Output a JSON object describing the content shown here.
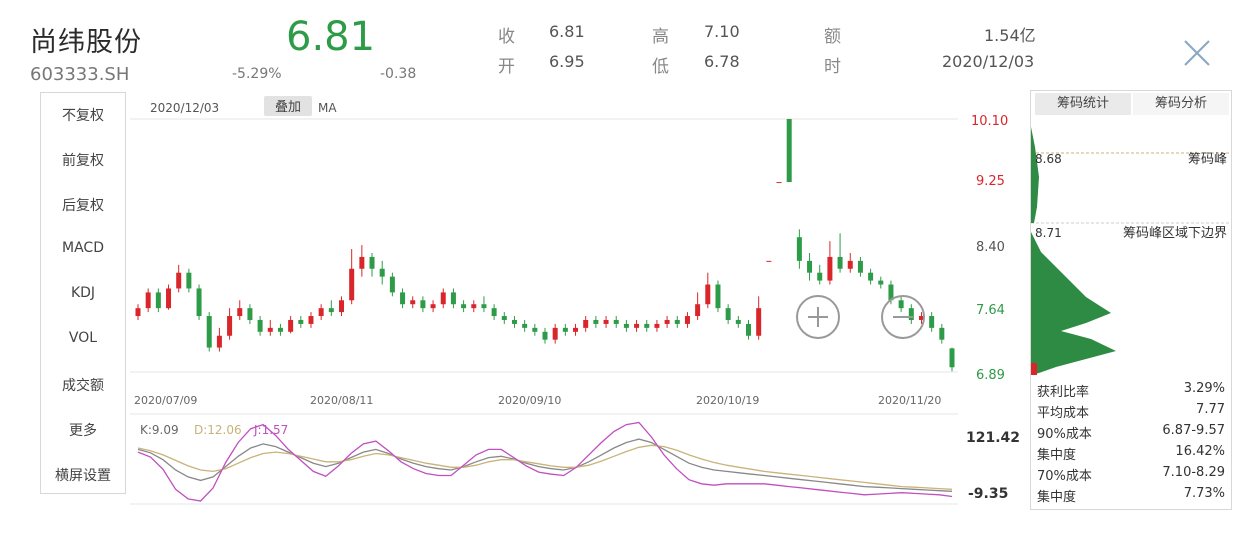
{
  "header": {
    "stock_name": "尚纬股份",
    "stock_code": "603333.SH",
    "price": "6.81",
    "change_pct": "-5.29%",
    "change_amt": "-0.38",
    "price_color": "#2e9b48",
    "quote": {
      "close_label": "收",
      "close_value": "6.81",
      "open_label": "开",
      "open_value": "6.95",
      "high_label": "高",
      "high_value": "7.10",
      "low_label": "低",
      "low_value": "6.78",
      "amount_label": "额",
      "amount_value": "1.54亿",
      "time_label": "时",
      "time_value": "2020/12/03"
    },
    "close_icon": "close-icon"
  },
  "left_menu": [
    {
      "label": "不复权",
      "active": false
    },
    {
      "label": "前复权",
      "active": true
    },
    {
      "label": "后复权",
      "active": false
    },
    {
      "label": "MACD",
      "active": false
    },
    {
      "label": "KDJ",
      "active": true
    },
    {
      "label": "VOL",
      "active": false
    },
    {
      "label": "成交额",
      "active": false
    },
    {
      "label": "更多",
      "active": false
    },
    {
      "label": "横屏设置",
      "active": true
    }
  ],
  "chart": {
    "date_label": "2020/12/03",
    "overlay_button": "叠加",
    "ma_label": "MA",
    "zoom_in_icon": "zoom-in-icon",
    "zoom_out_icon": "zoom-out-icon",
    "up_color": "#d9262b",
    "down_color": "#2e9b48"
  },
  "chart_data": [
    {
      "type": "candlestick",
      "title": "",
      "ylim": [
        6.89,
        10.1
      ],
      "y_ticks": [
        "10.10",
        "9.25",
        "8.40",
        "7.64",
        "6.89"
      ],
      "x_ticks": [
        "2020/07/09",
        "2020/08/11",
        "2020/09/10",
        "2020/10/19",
        "2020/11/20"
      ],
      "series": [
        {
          "o": 7.6,
          "c": 7.7,
          "h": 7.75,
          "l": 7.55
        },
        {
          "o": 7.7,
          "c": 7.9,
          "h": 7.95,
          "l": 7.65
        },
        {
          "o": 7.9,
          "c": 7.7,
          "h": 7.95,
          "l": 7.65
        },
        {
          "o": 7.7,
          "c": 7.95,
          "h": 8.0,
          "l": 7.68
        },
        {
          "o": 7.95,
          "c": 8.15,
          "h": 8.25,
          "l": 7.9
        },
        {
          "o": 8.15,
          "c": 7.95,
          "h": 8.2,
          "l": 7.9
        },
        {
          "o": 7.95,
          "c": 7.6,
          "h": 8.0,
          "l": 7.55
        },
        {
          "o": 7.6,
          "c": 7.2,
          "h": 7.65,
          "l": 7.15
        },
        {
          "o": 7.2,
          "c": 7.35,
          "h": 7.45,
          "l": 7.15
        },
        {
          "o": 7.35,
          "c": 7.6,
          "h": 7.7,
          "l": 7.3
        },
        {
          "o": 7.6,
          "c": 7.7,
          "h": 7.8,
          "l": 7.55
        },
        {
          "o": 7.7,
          "c": 7.55,
          "h": 7.75,
          "l": 7.5
        },
        {
          "o": 7.55,
          "c": 7.4,
          "h": 7.6,
          "l": 7.35
        },
        {
          "o": 7.4,
          "c": 7.45,
          "h": 7.55,
          "l": 7.35
        },
        {
          "o": 7.45,
          "c": 7.4,
          "h": 7.5,
          "l": 7.35
        },
        {
          "o": 7.4,
          "c": 7.55,
          "h": 7.6,
          "l": 7.38
        },
        {
          "o": 7.55,
          "c": 7.5,
          "h": 7.6,
          "l": 7.45
        },
        {
          "o": 7.5,
          "c": 7.6,
          "h": 7.65,
          "l": 7.45
        },
        {
          "o": 7.6,
          "c": 7.7,
          "h": 7.75,
          "l": 7.55
        },
        {
          "o": 7.7,
          "c": 7.65,
          "h": 7.8,
          "l": 7.6
        },
        {
          "o": 7.65,
          "c": 7.8,
          "h": 7.85,
          "l": 7.6
        },
        {
          "o": 7.8,
          "c": 8.2,
          "h": 8.45,
          "l": 7.75
        },
        {
          "o": 8.2,
          "c": 8.35,
          "h": 8.5,
          "l": 8.1
        },
        {
          "o": 8.35,
          "c": 8.2,
          "h": 8.4,
          "l": 8.1
        },
        {
          "o": 8.2,
          "c": 8.1,
          "h": 8.3,
          "l": 8.0
        },
        {
          "o": 8.1,
          "c": 7.9,
          "h": 8.15,
          "l": 7.85
        },
        {
          "o": 7.9,
          "c": 7.75,
          "h": 7.95,
          "l": 7.7
        },
        {
          "o": 7.75,
          "c": 7.8,
          "h": 7.85,
          "l": 7.7
        },
        {
          "o": 7.8,
          "c": 7.7,
          "h": 7.85,
          "l": 7.65
        },
        {
          "o": 7.7,
          "c": 7.75,
          "h": 7.8,
          "l": 7.65
        },
        {
          "o": 7.75,
          "c": 7.9,
          "h": 7.95,
          "l": 7.7
        },
        {
          "o": 7.9,
          "c": 7.75,
          "h": 7.95,
          "l": 7.7
        },
        {
          "o": 7.75,
          "c": 7.7,
          "h": 7.8,
          "l": 7.65
        },
        {
          "o": 7.7,
          "c": 7.75,
          "h": 7.8,
          "l": 7.65
        },
        {
          "o": 7.75,
          "c": 7.7,
          "h": 7.85,
          "l": 7.65
        },
        {
          "o": 7.7,
          "c": 7.6,
          "h": 7.75,
          "l": 7.55
        },
        {
          "o": 7.6,
          "c": 7.55,
          "h": 7.65,
          "l": 7.5
        },
        {
          "o": 7.55,
          "c": 7.5,
          "h": 7.6,
          "l": 7.45
        },
        {
          "o": 7.5,
          "c": 7.45,
          "h": 7.55,
          "l": 7.4
        },
        {
          "o": 7.45,
          "c": 7.4,
          "h": 7.5,
          "l": 7.35
        },
        {
          "o": 7.4,
          "c": 7.3,
          "h": 7.45,
          "l": 7.25
        },
        {
          "o": 7.3,
          "c": 7.45,
          "h": 7.5,
          "l": 7.25
        },
        {
          "o": 7.45,
          "c": 7.4,
          "h": 7.5,
          "l": 7.35
        },
        {
          "o": 7.4,
          "c": 7.45,
          "h": 7.5,
          "l": 7.35
        },
        {
          "o": 7.45,
          "c": 7.55,
          "h": 7.6,
          "l": 7.4
        },
        {
          "o": 7.55,
          "c": 7.5,
          "h": 7.6,
          "l": 7.45
        },
        {
          "o": 7.5,
          "c": 7.55,
          "h": 7.6,
          "l": 7.45
        },
        {
          "o": 7.55,
          "c": 7.5,
          "h": 7.6,
          "l": 7.45
        },
        {
          "o": 7.5,
          "c": 7.45,
          "h": 7.55,
          "l": 7.4
        },
        {
          "o": 7.45,
          "c": 7.5,
          "h": 7.55,
          "l": 7.4
        },
        {
          "o": 7.5,
          "c": 7.45,
          "h": 7.55,
          "l": 7.4
        },
        {
          "o": 7.45,
          "c": 7.5,
          "h": 7.55,
          "l": 7.4
        },
        {
          "o": 7.5,
          "c": 7.55,
          "h": 7.6,
          "l": 7.45
        },
        {
          "o": 7.55,
          "c": 7.5,
          "h": 7.6,
          "l": 7.45
        },
        {
          "o": 7.5,
          "c": 7.6,
          "h": 7.65,
          "l": 7.45
        },
        {
          "o": 7.6,
          "c": 7.75,
          "h": 7.9,
          "l": 7.55
        },
        {
          "o": 7.75,
          "c": 8.0,
          "h": 8.15,
          "l": 7.7
        },
        {
          "o": 8.0,
          "c": 7.7,
          "h": 8.05,
          "l": 7.65
        },
        {
          "o": 7.7,
          "c": 7.55,
          "h": 7.75,
          "l": 7.5
        },
        {
          "o": 7.55,
          "c": 7.5,
          "h": 7.6,
          "l": 7.45
        },
        {
          "o": 7.5,
          "c": 7.35,
          "h": 7.55,
          "l": 7.3
        },
        {
          "o": 7.35,
          "c": 7.7,
          "h": 7.85,
          "l": 7.3
        },
        {
          "o": 8.3,
          "c": 8.3,
          "h": 8.3,
          "l": 8.3
        },
        {
          "o": 9.3,
          "c": 9.3,
          "h": 9.3,
          "l": 9.3
        },
        {
          "o": 10.1,
          "c": 9.3,
          "h": 10.1,
          "l": 9.3
        },
        {
          "o": 8.6,
          "c": 8.3,
          "h": 8.7,
          "l": 8.2
        },
        {
          "o": 8.3,
          "c": 8.15,
          "h": 8.4,
          "l": 8.05
        },
        {
          "o": 8.15,
          "c": 8.05,
          "h": 8.25,
          "l": 8.0
        },
        {
          "o": 8.05,
          "c": 8.35,
          "h": 8.55,
          "l": 8.0
        },
        {
          "o": 8.35,
          "c": 8.2,
          "h": 8.65,
          "l": 8.15
        },
        {
          "o": 8.2,
          "c": 8.3,
          "h": 8.4,
          "l": 8.15
        },
        {
          "o": 8.3,
          "c": 8.15,
          "h": 8.35,
          "l": 8.1
        },
        {
          "o": 8.15,
          "c": 8.05,
          "h": 8.2,
          "l": 8.0
        },
        {
          "o": 8.05,
          "c": 8.0,
          "h": 8.1,
          "l": 7.95
        },
        {
          "o": 8.0,
          "c": 7.8,
          "h": 8.05,
          "l": 7.75
        },
        {
          "o": 7.8,
          "c": 7.7,
          "h": 7.85,
          "l": 7.65
        },
        {
          "o": 7.7,
          "c": 7.55,
          "h": 7.75,
          "l": 7.5
        },
        {
          "o": 7.55,
          "c": 7.6,
          "h": 7.65,
          "l": 7.5
        },
        {
          "o": 7.6,
          "c": 7.45,
          "h": 7.65,
          "l": 7.4
        },
        {
          "o": 7.45,
          "c": 7.3,
          "h": 7.5,
          "l": 7.25
        },
        {
          "o": 7.19,
          "c": 6.95,
          "h": 7.2,
          "l": 6.9
        }
      ]
    },
    {
      "type": "line",
      "title": "KDJ",
      "legend": [
        {
          "name": "K:9.09",
          "color": "#666666"
        },
        {
          "name": "D:12.06",
          "color": "#c9b37a"
        },
        {
          "name": "J:1.57",
          "color": "#c04fbf"
        }
      ],
      "ylim": [
        -9.35,
        121.42
      ],
      "y_ticks": [
        "121.42",
        "-9.35"
      ],
      "series": [
        {
          "name": "K",
          "color": "#888888",
          "values": [
            70,
            65,
            55,
            40,
            30,
            25,
            30,
            45,
            60,
            72,
            78,
            74,
            66,
            58,
            50,
            45,
            50,
            58,
            66,
            70,
            64,
            56,
            50,
            45,
            42,
            40,
            45,
            52,
            58,
            60,
            56,
            50,
            45,
            42,
            40,
            44,
            52,
            62,
            72,
            80,
            85,
            80,
            70,
            60,
            50,
            44,
            40,
            38,
            36,
            34,
            32,
            30,
            28,
            26,
            24,
            22,
            20,
            18,
            16,
            15,
            14,
            13,
            12,
            11,
            10,
            9.09
          ]
        },
        {
          "name": "D",
          "color": "#c9b37a",
          "values": [
            72,
            68,
            62,
            54,
            46,
            40,
            38,
            42,
            50,
            58,
            64,
            66,
            64,
            60,
            56,
            52,
            52,
            55,
            60,
            64,
            62,
            58,
            54,
            50,
            47,
            44,
            44,
            47,
            52,
            55,
            55,
            52,
            49,
            46,
            44,
            44,
            47,
            53,
            60,
            67,
            73,
            76,
            74,
            69,
            62,
            56,
            51,
            47,
            44,
            41,
            38,
            36,
            34,
            32,
            30,
            28,
            26,
            24,
            22,
            20,
            18,
            16,
            15,
            14,
            13,
            12.06
          ]
        },
        {
          "name": "J",
          "color": "#c04fbf",
          "values": [
            66,
            59,
            41,
            12,
            -2,
            -5,
            14,
            51,
            80,
            100,
            106,
            90,
            70,
            54,
            38,
            31,
            46,
            64,
            78,
            82,
            68,
            52,
            42,
            35,
            32,
            32,
            47,
            62,
            70,
            70,
            58,
            46,
            37,
            34,
            32,
            44,
            62,
            80,
            96,
            106,
            109,
            88,
            62,
            42,
            26,
            20,
            18,
            20,
            20,
            20,
            20,
            18,
            16,
            14,
            12,
            10,
            8,
            6,
            4,
            5,
            6,
            7,
            6,
            5,
            4,
            1.57
          ]
        }
      ]
    },
    {
      "type": "bar",
      "title": "筹码统计",
      "orientation": "horizontal",
      "price_marks": [
        "8.68",
        "8.71"
      ],
      "annotations": [
        "筹码峰",
        "筹码峰区域下边界"
      ],
      "note": "chip distribution profile"
    }
  ],
  "chip_panel": {
    "tab_stats": "筹码统计",
    "tab_analysis": "筹码分析",
    "mark_top_price": "8.68",
    "mark_top_text": "筹码峰",
    "mark_mid_price": "8.71",
    "mark_mid_text": "筹码峰区域下边界",
    "stats": [
      {
        "label": "获利比率",
        "value": "3.29%"
      },
      {
        "label": "平均成本",
        "value": "7.77"
      },
      {
        "label": "90%成本",
        "value": "6.87-9.57"
      },
      {
        "label": "集中度",
        "value": "16.42%"
      },
      {
        "label": "70%成本",
        "value": "7.10-8.29"
      },
      {
        "label": "集中度",
        "value": "7.73%"
      }
    ]
  }
}
